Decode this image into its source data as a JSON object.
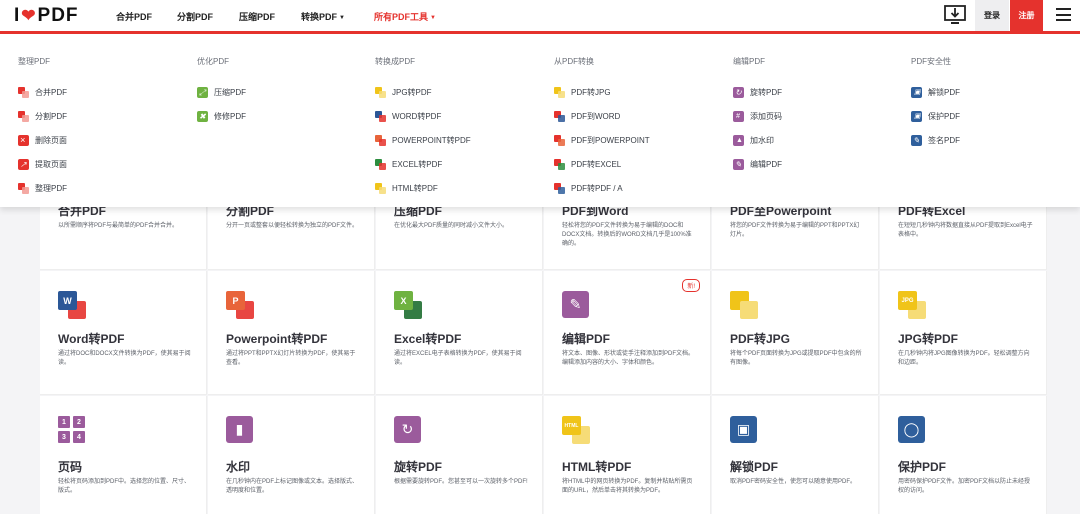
{
  "nav": {
    "logo_text_left": "I",
    "logo_text_right": "PDF",
    "links": [
      "合并PDF",
      "分割PDF",
      "压缩PDF",
      "转换PDF",
      "所有PDF工具"
    ],
    "login": "登录",
    "signup": "注册"
  },
  "dropdown": {
    "columns": [
      {
        "title": "整理PDF",
        "items": [
          "合并PDF",
          "分割PDF",
          "删除页面",
          "提取页面",
          "整理PDF"
        ]
      },
      {
        "title": "优化PDF",
        "items": [
          "压缩PDF",
          "修修PDF"
        ]
      },
      {
        "title": "转换成PDF",
        "items": [
          "JPG转PDF",
          "WORD转PDF",
          "POWERPOINT转PDF",
          "EXCEL转PDF",
          "HTML转PDF"
        ]
      },
      {
        "title": "从PDF转换",
        "items": [
          "PDF转JPG",
          "PDF到WORD",
          "PDF到POWERPOINT",
          "PDF转EXCEL",
          "PDF转PDF / A"
        ]
      },
      {
        "title": "编辑PDF",
        "items": [
          "旋转PDF",
          "添加页码",
          "加水印",
          "编辑PDF"
        ]
      },
      {
        "title": "PDF安全性",
        "items": [
          "解锁PDF",
          "保护PDF",
          "签名PDF"
        ]
      }
    ]
  },
  "cards": {
    "row1": [
      {
        "title": "合并PDF",
        "desc": "以所需顺序将PDF与最简单的PDF合并合并。"
      },
      {
        "title": "分割PDF",
        "desc": "分开一页或整套以便轻松转换为独立的PDF文件。"
      },
      {
        "title": "压缩PDF",
        "desc": "在优化最大PDF质量的同时减小文件大小。"
      },
      {
        "title": "PDF到Word",
        "desc": "轻松将您的PDF文件转换为易于编辑的DOC和DOCX文档。转换后的WORD文档几乎是100%准确的。"
      },
      {
        "title": "PDF至Powerpoint",
        "desc": "将您的PDF文件转换为易于编辑的PPT和PPTX幻灯片。"
      },
      {
        "title": "PDF转Excel",
        "desc": "在短短几秒钟内将数据直接从PDF提取到Excel电子表格中。"
      }
    ],
    "row2": [
      {
        "title": "Word转PDF",
        "desc": "通过将DOC和DOCX文件转换为PDF，使其易于阅读。"
      },
      {
        "title": "Powerpoint转PDF",
        "desc": "通过将PPT和PPTX幻灯片转换为PDF，使其易于查看。"
      },
      {
        "title": "Excel转PDF",
        "desc": "通过将EXCEL电子表格转换为PDF，使其易于阅读。"
      },
      {
        "title": "编辑PDF",
        "desc": "将文本、图像、形状或徒手注释添加到PDF文档。编辑添加内容的大小、字体和颜色。",
        "badge": "新!"
      },
      {
        "title": "PDF转JPG",
        "desc": "将每个PDF页面转换为JPG或提取PDF中包含的所有图像。"
      },
      {
        "title": "JPG转PDF",
        "desc": "在几秒钟内将JPG图像转换为PDF。轻松调整方向和边距。"
      }
    ],
    "row3": [
      {
        "title": "页码",
        "desc": "轻松将页码添加到PDF中。选择您的位置、尺寸、版式。"
      },
      {
        "title": "水印",
        "desc": "在几秒钟内在PDF上标记图像或文本。选择版式、透明度和位置。"
      },
      {
        "title": "旋转PDF",
        "desc": "根据需要旋转PDF。您甚至可以一次旋转多个PDF!"
      },
      {
        "title": "HTML转PDF",
        "desc": "将HTML中的网页转换为PDF。复制并粘贴所需页面的URL，然后单击将其转换为PDF。"
      },
      {
        "title": "解锁PDF",
        "desc": "取消PDF密码安全性，使您可以随意使用PDF。"
      },
      {
        "title": "保护PDF",
        "desc": "用密码保护PDF文件。加密PDF文档以防止未经授权的访问。"
      }
    ]
  },
  "icons": {
    "word": "W",
    "ppt": "P",
    "excel": "X",
    "jpg": "JPG",
    "html": "HTML",
    "page_numbers": [
      "1",
      "2",
      "3",
      "4"
    ]
  },
  "colors": {
    "brand_red": "#e5322d",
    "merge": "#e5322d",
    "compress": "#6fb241",
    "word": "#2b5797",
    "excel": "#2d8e3f",
    "jpg": "#f0c419",
    "purple": "#9b5b9c",
    "blue": "#2f5f9c"
  }
}
